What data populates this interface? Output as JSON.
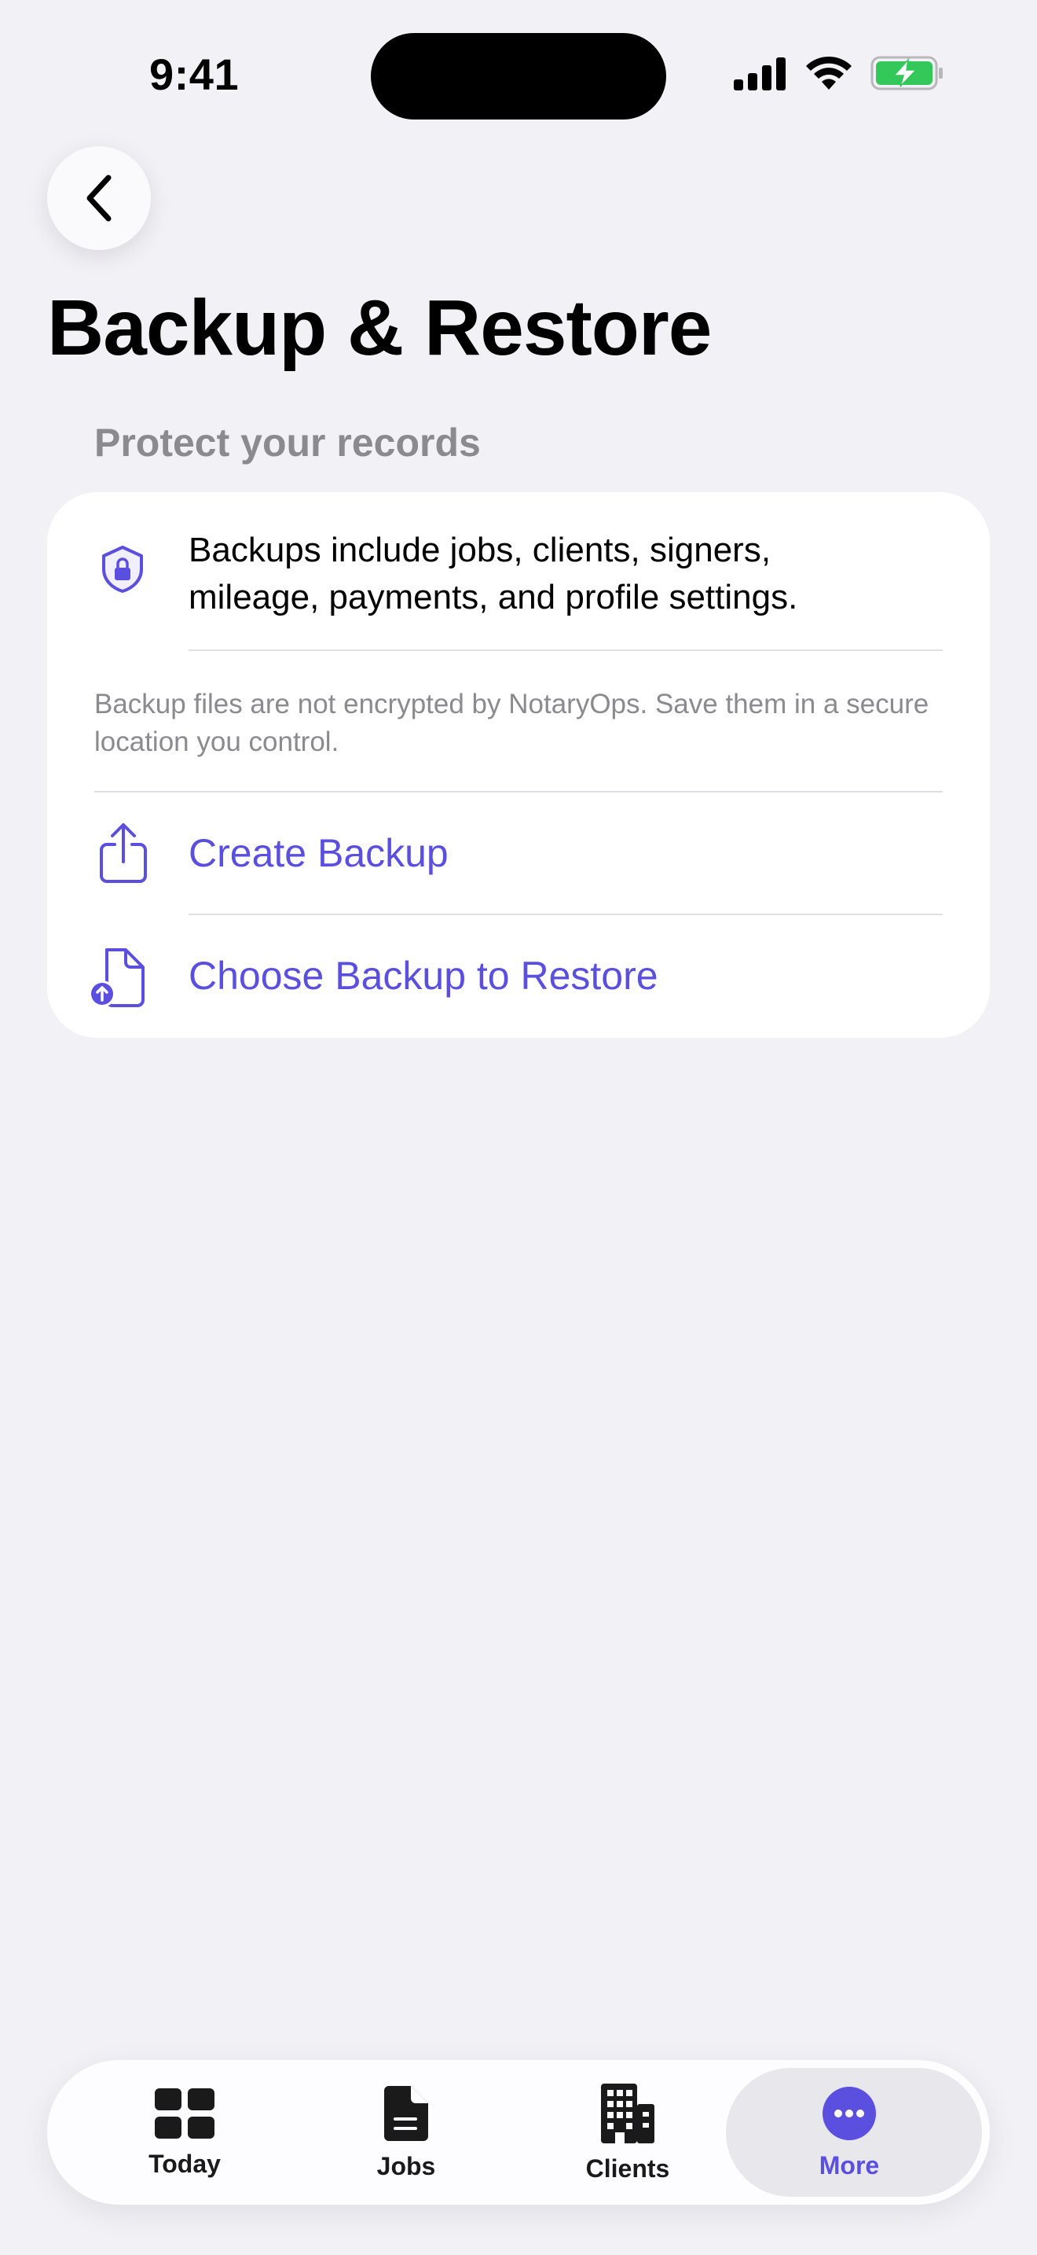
{
  "status_bar": {
    "time": "9:41"
  },
  "header": {
    "back_icon": "chevron-left-icon",
    "title": "Backup & Restore"
  },
  "section": {
    "header": "Protect your records",
    "info": {
      "icon": "shield-lock-icon",
      "text": "Backups include jobs, clients, signers, mileage, payments, and profile settings."
    },
    "note": "Backup files are not encrypted by NotaryOps. Save them in a secure location you control.",
    "actions": [
      {
        "icon": "share-upload-icon",
        "label": "Create Backup"
      },
      {
        "icon": "document-upload-icon",
        "label": "Choose Backup to Restore"
      }
    ]
  },
  "tab_bar": {
    "tabs": [
      {
        "icon": "grid-icon",
        "label": "Today"
      },
      {
        "icon": "document-icon",
        "label": "Jobs"
      },
      {
        "icon": "building-icon",
        "label": "Clients"
      },
      {
        "icon": "ellipsis-circle-icon",
        "label": "More"
      }
    ],
    "selected": "More"
  },
  "colors": {
    "accent": "#5B4FE0",
    "background": "#F2F1F6",
    "battery": "#34C759"
  }
}
